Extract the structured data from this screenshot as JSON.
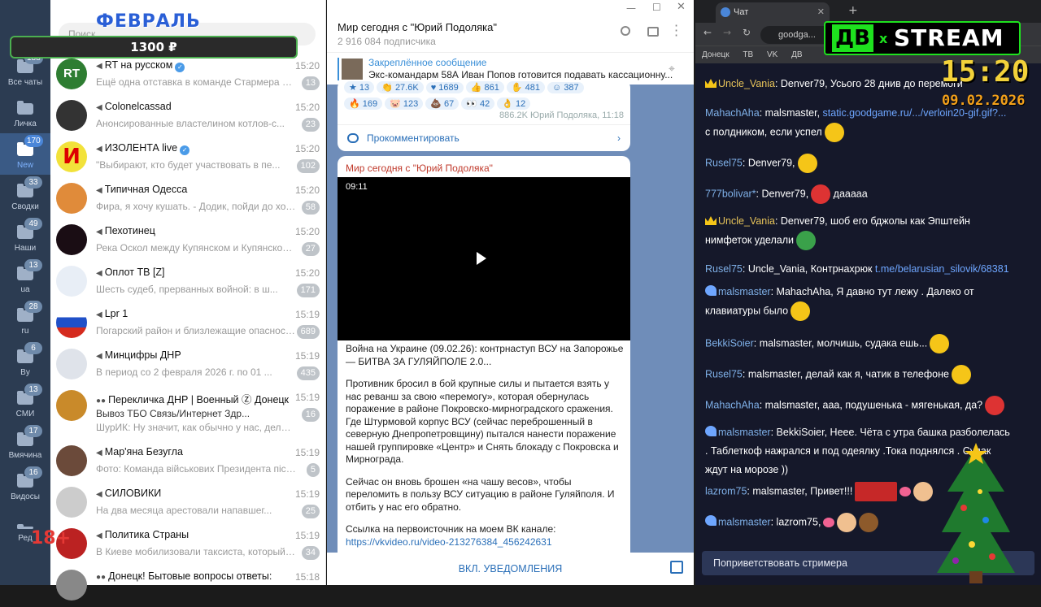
{
  "overlay": {
    "month": "ФЕВРАЛЬ",
    "amount": "1300 ₽",
    "age_rating": "18+",
    "logo_left": "ДВ",
    "logo_x": "x",
    "logo_right": "STREAM",
    "clock": "15:20",
    "date": "09.02.2026"
  },
  "rail": {
    "items": [
      {
        "label": "Все чаты",
        "badge": "188"
      },
      {
        "label": "Личка",
        "badge": ""
      },
      {
        "label": "New",
        "badge": "170"
      },
      {
        "label": "Сводки",
        "badge": "33"
      },
      {
        "label": "Наши",
        "badge": "49"
      },
      {
        "label": "ua",
        "badge": "13"
      },
      {
        "label": "ru",
        "badge": "28"
      },
      {
        "label": "By",
        "badge": "6"
      },
      {
        "label": "СМИ",
        "badge": "13"
      },
      {
        "label": "Вмячина",
        "badge": "17"
      },
      {
        "label": "Видосы",
        "badge": "16"
      },
      {
        "label": "Ред",
        "badge": ""
      }
    ]
  },
  "chatlist": {
    "search_placeholder": "Поиск",
    "chats": [
      {
        "name": "RT на русском",
        "time": "15:20",
        "preview": "Ещё одна отставка в команде Стармера после ...",
        "count": "13"
      },
      {
        "name": "Colonelcassad",
        "time": "15:20",
        "preview": "Анонсированные властелином котлов-с...",
        "count": "23"
      },
      {
        "name": "ИЗОЛЕНТА live",
        "time": "15:20",
        "preview": "\"Выбирают, кто будет участвовать в пе...",
        "count": "102"
      },
      {
        "name": "Типичная Одесса",
        "time": "15:20",
        "preview": "Фира, я хочу кушать. - Додик, пойди до холод...",
        "count": "58"
      },
      {
        "name": "Пехотинец",
        "time": "15:20",
        "preview": "Река Оскол между Купянском и Купянском-...",
        "count": "27"
      },
      {
        "name": "Оплот ТВ [Z]",
        "time": "15:20",
        "preview": "Шесть судеб, прерванных войной: в ш...",
        "count": "171"
      },
      {
        "name": "Lpr 1",
        "time": "15:19",
        "preview": "Погарский район и близлежащие опасность ...",
        "count": "689"
      },
      {
        "name": "Минцифры ДНР",
        "time": "15:19",
        "preview": "В период со 2 февраля 2026 г. по 01 ...",
        "count": "435"
      },
      {
        "name": "Перекличка ДНР | Военный Ⓩ Донецк",
        "time": "15:19",
        "preview": "Вывоз ТБО   Связь/Интернет   Здр...",
        "preview2": "ШурИК: Ну значит, как обычно у нас, делали ...",
        "count": "16"
      },
      {
        "name": "Мар'яна Безугла",
        "time": "15:19",
        "preview": "Фото: Команда військових Президента пісЛ...",
        "count": "5"
      },
      {
        "name": "СИЛОВИКИ",
        "time": "15:19",
        "preview": "На два месяца арестовали напавшег...",
        "count": "25"
      },
      {
        "name": "Политика Страны",
        "time": "15:19",
        "preview": "В Киеве мобилизовали таксиста, который в...",
        "count": "34"
      },
      {
        "name": "Донецк! Бытовые вопросы ответы:",
        "time": "15:18",
        "preview": "",
        "count": ""
      }
    ]
  },
  "channel": {
    "title": "Мир сегодня с \"Юрий Подоляка\"",
    "subscribers": "2 916 084 подписчика",
    "pinned_label": "Закреплённое сообщение",
    "pinned_text": "Экс-командарм 58А Иван Попов готовится подавать кассационну...",
    "reactions_row1": [
      "13",
      "27.6K",
      "1689",
      "861",
      "481",
      "387"
    ],
    "reactions_row2": [
      "169",
      "123",
      "67",
      "42",
      "12"
    ],
    "views": "886.2K  Юрий Подоляка, 11:18",
    "comment_label": "Прокомментировать",
    "post_author": "Мир сегодня с \"Юрий Подоляка\"",
    "video_duration": "09:11",
    "post_headline": "Война на Украине (09.02.26): контрнаступ ВСУ на Запорожье — БИТВА ЗА ГУЛЯЙПОЛЕ 2.0...",
    "post_p1": "Противник бросил в бой крупные силы и пытается взять у нас реванш за свою «перемогу», которая обернулась поражение в районе Покровско-мирноградского сражения. Где Штурмовой корпус ВСУ (сейчас переброшенный в северную Днепропетровщину) пытался нанести поражение нашей группировке «Центр» и Снять блокаду с Покровска и Мирнограда.",
    "post_p2": "Сейчас он вновь брошен «на чашу весов», чтобы переломить в пользу ВСУ ситуацию в районе Гуляйполя. И отбить у нас его обратно.",
    "post_p3": "Ссылка на первоисточник на моем ВК канале:",
    "post_link": "https://vkvideo.ru/video-213276384_456242631",
    "notify_label": "ВКЛ. УВЕДОМЛЕНИЯ"
  },
  "browser": {
    "tab_title": "Чат",
    "address": "goodga...",
    "bookmarks": [
      "Донецк",
      "ТВ",
      "VK",
      "ДВ"
    ],
    "greet_button": "Поприветствовать стримера",
    "messages": [
      {
        "user": "Uncle_Vania",
        "text": "Denver79, Усього 28 днив до перемоги",
        "gold": true
      },
      {
        "user": "MahachAha",
        "text": "malsmaster, ",
        "link": "static.goodgame.ru/.../verloin20-gif.gif?...",
        "text2": " с полдником, если успел"
      },
      {
        "user": "Rusel75",
        "text": "Denver79,"
      },
      {
        "user": "777bolivar*",
        "text": "Denver79,",
        "text2": " дааааа"
      },
      {
        "user": "Uncle_Vania",
        "text": "Denver79, шоб его бджолы как Эпштейн нимфеток уделали",
        "gold": true
      },
      {
        "user": "Rusel75",
        "text": "Uncle_Vania, Контрнахрюк ",
        "link": "t.me/belarusian_silovik/68381"
      },
      {
        "user": "malsmaster",
        "text": "MahachAha, Я давно тут лежу . Далеко от клавиатуры было"
      },
      {
        "user": "BekkiSoier",
        "text": "malsmaster, молчишь, судака ешь..."
      },
      {
        "user": "Rusel75",
        "text": "malsmaster, делай как я, чатик в телефоне"
      },
      {
        "user": "MahachAha",
        "text": "malsmaster, ааа, подушенька - мягенькая, да?"
      },
      {
        "user": "malsmaster",
        "text": "BekkiSoier, Неее. Чёта с утра башка разболелась . Таблеткоф нажрался и под одеялку .Тока поднялся . Судак ждут на морозе ))"
      },
      {
        "user": "lazrom75",
        "text": "malsmaster, Привет!!!"
      },
      {
        "user": "malsmaster",
        "text": "lazrom75,"
      }
    ]
  }
}
